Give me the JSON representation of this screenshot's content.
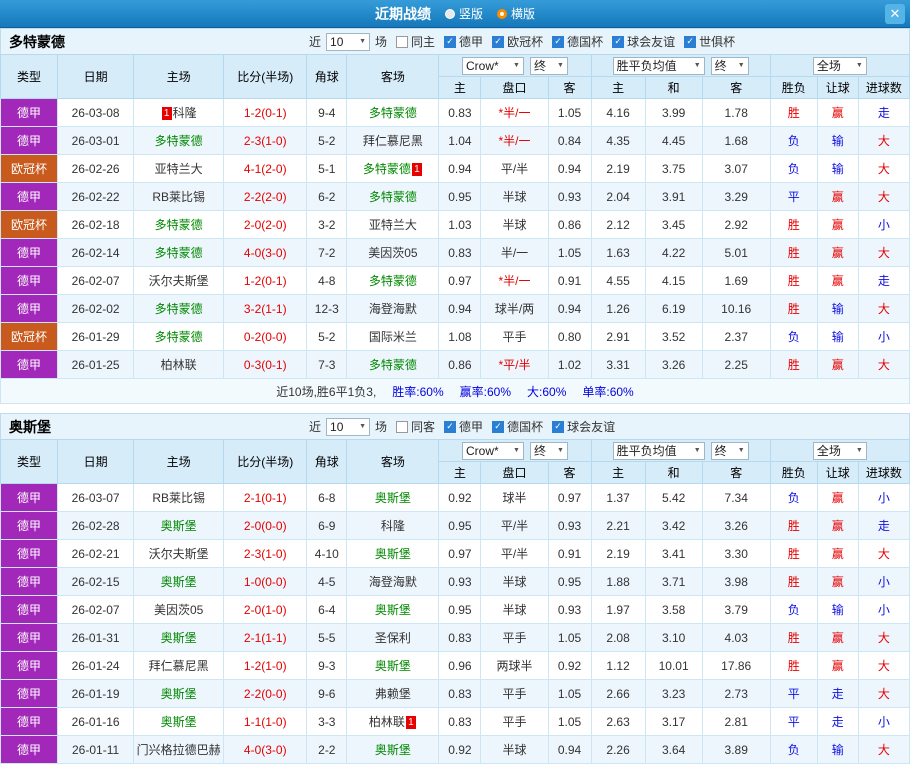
{
  "titlebar": {
    "title": "近期战绩",
    "radio_vertical": "竖版",
    "radio_horizontal": "横版",
    "close": "✕"
  },
  "colors": {
    "league": {
      "德甲": "#a128b8",
      "欧冠杯": "#c85a1d"
    },
    "team_green": "#008800",
    "win_red": "#e60000",
    "lose_blue": "#1010e0"
  },
  "table_header": {
    "cols": [
      "类型",
      "日期",
      "主场",
      "比分(半场)",
      "角球",
      "客场"
    ],
    "company_select": "Crow*",
    "final_select": "终",
    "avg_select": "胜平负均值",
    "scope_select": "全场",
    "sub_cols": [
      "主",
      "盘口",
      "客",
      "主",
      "和",
      "客",
      "胜负",
      "让球",
      "进球数"
    ]
  },
  "sections": [
    {
      "team": "多特蒙德",
      "filter": {
        "near": "近",
        "count": "10",
        "unit": "场",
        "checkboxes": [
          {
            "label": "同主",
            "checked": false
          },
          {
            "label": "德甲",
            "checked": true
          },
          {
            "label": "欧冠杯",
            "checked": true
          },
          {
            "label": "德国杯",
            "checked": true
          },
          {
            "label": "球会友谊",
            "checked": true
          },
          {
            "label": "世俱杯",
            "checked": true
          }
        ]
      },
      "rows": [
        {
          "league": "德甲",
          "date": "26-03-08",
          "home": {
            "name": "科隆",
            "green": false,
            "badge_before": "1"
          },
          "score": "1-2(0-1)",
          "corner": "9-4",
          "away": {
            "name": "多特蒙德",
            "green": true
          },
          "odds": [
            "0.83",
            "*半/一",
            "1.05"
          ],
          "handicap_red": true,
          "avg": [
            "4.16",
            "3.99",
            "1.78"
          ],
          "results": [
            {
              "text": "胜",
              "color": "red"
            },
            {
              "text": "赢",
              "color": "red"
            },
            {
              "text": "走",
              "color": "blue"
            }
          ]
        },
        {
          "league": "德甲",
          "date": "26-03-01",
          "home": {
            "name": "多特蒙德",
            "green": true
          },
          "score": "2-3(1-0)",
          "corner": "5-2",
          "away": {
            "name": "拜仁慕尼黑",
            "green": false
          },
          "odds": [
            "1.04",
            "*半/一",
            "0.84"
          ],
          "handicap_red": true,
          "avg": [
            "4.35",
            "4.45",
            "1.68"
          ],
          "results": [
            {
              "text": "负",
              "color": "blue"
            },
            {
              "text": "输",
              "color": "blue"
            },
            {
              "text": "大",
              "color": "red"
            }
          ]
        },
        {
          "league": "欧冠杯",
          "date": "26-02-26",
          "home": {
            "name": "亚特兰大",
            "green": false
          },
          "score": "4-1(2-0)",
          "corner": "5-1",
          "away": {
            "name": "多特蒙德",
            "green": true,
            "badge_after": "1"
          },
          "odds": [
            "0.94",
            "平/半",
            "0.94"
          ],
          "handicap_red": false,
          "avg": [
            "2.19",
            "3.75",
            "3.07"
          ],
          "results": [
            {
              "text": "负",
              "color": "blue"
            },
            {
              "text": "输",
              "color": "blue"
            },
            {
              "text": "大",
              "color": "red"
            }
          ]
        },
        {
          "league": "德甲",
          "date": "26-02-22",
          "home": {
            "name": "RB莱比锡",
            "green": false
          },
          "score": "2-2(2-0)",
          "corner": "6-2",
          "away": {
            "name": "多特蒙德",
            "green": true
          },
          "odds": [
            "0.95",
            "半球",
            "0.93"
          ],
          "handicap_red": false,
          "avg": [
            "2.04",
            "3.91",
            "3.29"
          ],
          "results": [
            {
              "text": "平",
              "color": "blue"
            },
            {
              "text": "赢",
              "color": "red"
            },
            {
              "text": "大",
              "color": "red"
            }
          ]
        },
        {
          "league": "欧冠杯",
          "date": "26-02-18",
          "home": {
            "name": "多特蒙德",
            "green": true
          },
          "score": "2-0(2-0)",
          "corner": "3-2",
          "away": {
            "name": "亚特兰大",
            "green": false
          },
          "odds": [
            "1.03",
            "半球",
            "0.86"
          ],
          "handicap_red": false,
          "avg": [
            "2.12",
            "3.45",
            "2.92"
          ],
          "results": [
            {
              "text": "胜",
              "color": "red"
            },
            {
              "text": "赢",
              "color": "red"
            },
            {
              "text": "小",
              "color": "blue"
            }
          ]
        },
        {
          "league": "德甲",
          "date": "26-02-14",
          "home": {
            "name": "多特蒙德",
            "green": true
          },
          "score": "4-0(3-0)",
          "corner": "7-2",
          "away": {
            "name": "美因茨05",
            "green": false
          },
          "odds": [
            "0.83",
            "半/一",
            "1.05"
          ],
          "handicap_red": false,
          "avg": [
            "1.63",
            "4.22",
            "5.01"
          ],
          "results": [
            {
              "text": "胜",
              "color": "red"
            },
            {
              "text": "赢",
              "color": "red"
            },
            {
              "text": "大",
              "color": "red"
            }
          ]
        },
        {
          "league": "德甲",
          "date": "26-02-07",
          "home": {
            "name": "沃尔夫斯堡",
            "green": false
          },
          "score": "1-2(0-1)",
          "corner": "4-8",
          "away": {
            "name": "多特蒙德",
            "green": true
          },
          "odds": [
            "0.97",
            "*半/一",
            "0.91"
          ],
          "handicap_red": true,
          "avg": [
            "4.55",
            "4.15",
            "1.69"
          ],
          "results": [
            {
              "text": "胜",
              "color": "red"
            },
            {
              "text": "赢",
              "color": "red"
            },
            {
              "text": "走",
              "color": "blue"
            }
          ]
        },
        {
          "league": "德甲",
          "date": "26-02-02",
          "home": {
            "name": "多特蒙德",
            "green": true
          },
          "score": "3-2(1-1)",
          "corner": "12-3",
          "away": {
            "name": "海登海默",
            "green": false
          },
          "odds": [
            "0.94",
            "球半/两",
            "0.94"
          ],
          "handicap_red": false,
          "avg": [
            "1.26",
            "6.19",
            "10.16"
          ],
          "results": [
            {
              "text": "胜",
              "color": "red"
            },
            {
              "text": "输",
              "color": "blue"
            },
            {
              "text": "大",
              "color": "red"
            }
          ]
        },
        {
          "league": "欧冠杯",
          "date": "26-01-29",
          "home": {
            "name": "多特蒙德",
            "green": true
          },
          "score": "0-2(0-0)",
          "corner": "5-2",
          "away": {
            "name": "国际米兰",
            "green": false
          },
          "odds": [
            "1.08",
            "平手",
            "0.80"
          ],
          "handicap_red": false,
          "avg": [
            "2.91",
            "3.52",
            "2.37"
          ],
          "results": [
            {
              "text": "负",
              "color": "blue"
            },
            {
              "text": "输",
              "color": "blue"
            },
            {
              "text": "小",
              "color": "blue"
            }
          ]
        },
        {
          "league": "德甲",
          "date": "26-01-25",
          "home": {
            "name": "柏林联",
            "green": false
          },
          "score": "0-3(0-1)",
          "corner": "7-3",
          "away": {
            "name": "多特蒙德",
            "green": true
          },
          "odds": [
            "0.86",
            "*平/半",
            "1.02"
          ],
          "handicap_red": true,
          "avg": [
            "3.31",
            "3.26",
            "2.25"
          ],
          "results": [
            {
              "text": "胜",
              "color": "red"
            },
            {
              "text": "赢",
              "color": "red"
            },
            {
              "text": "大",
              "color": "red"
            }
          ]
        }
      ],
      "summary": {
        "text": "近10场,胜6平1负3,",
        "stats": [
          "胜率:60%",
          "赢率:60%",
          "大:60%",
          "单率:60%"
        ]
      }
    },
    {
      "team": "奥斯堡",
      "filter": {
        "near": "近",
        "count": "10",
        "unit": "场",
        "checkboxes": [
          {
            "label": "同客",
            "checked": false
          },
          {
            "label": "德甲",
            "checked": true
          },
          {
            "label": "德国杯",
            "checked": true
          },
          {
            "label": "球会友谊",
            "checked": true
          }
        ]
      },
      "rows": [
        {
          "league": "德甲",
          "date": "26-03-07",
          "home": {
            "name": "RB莱比锡",
            "green": false
          },
          "score": "2-1(0-1)",
          "corner": "6-8",
          "away": {
            "name": "奥斯堡",
            "green": true
          },
          "odds": [
            "0.92",
            "球半",
            "0.97"
          ],
          "handicap_red": false,
          "avg": [
            "1.37",
            "5.42",
            "7.34"
          ],
          "results": [
            {
              "text": "负",
              "color": "blue"
            },
            {
              "text": "赢",
              "color": "red"
            },
            {
              "text": "小",
              "color": "blue"
            }
          ]
        },
        {
          "league": "德甲",
          "date": "26-02-28",
          "home": {
            "name": "奥斯堡",
            "green": true
          },
          "score": "2-0(0-0)",
          "corner": "6-9",
          "away": {
            "name": "科隆",
            "green": false
          },
          "odds": [
            "0.95",
            "平/半",
            "0.93"
          ],
          "handicap_red": false,
          "avg": [
            "2.21",
            "3.42",
            "3.26"
          ],
          "results": [
            {
              "text": "胜",
              "color": "red"
            },
            {
              "text": "赢",
              "color": "red"
            },
            {
              "text": "走",
              "color": "blue"
            }
          ]
        },
        {
          "league": "德甲",
          "date": "26-02-21",
          "home": {
            "name": "沃尔夫斯堡",
            "green": false
          },
          "score": "2-3(1-0)",
          "corner": "4-10",
          "away": {
            "name": "奥斯堡",
            "green": true
          },
          "odds": [
            "0.97",
            "平/半",
            "0.91"
          ],
          "handicap_red": false,
          "avg": [
            "2.19",
            "3.41",
            "3.30"
          ],
          "results": [
            {
              "text": "胜",
              "color": "red"
            },
            {
              "text": "赢",
              "color": "red"
            },
            {
              "text": "大",
              "color": "red"
            }
          ]
        },
        {
          "league": "德甲",
          "date": "26-02-15",
          "home": {
            "name": "奥斯堡",
            "green": true
          },
          "score": "1-0(0-0)",
          "corner": "4-5",
          "away": {
            "name": "海登海默",
            "green": false
          },
          "odds": [
            "0.93",
            "半球",
            "0.95"
          ],
          "handicap_red": false,
          "avg": [
            "1.88",
            "3.71",
            "3.98"
          ],
          "results": [
            {
              "text": "胜",
              "color": "red"
            },
            {
              "text": "赢",
              "color": "red"
            },
            {
              "text": "小",
              "color": "blue"
            }
          ]
        },
        {
          "league": "德甲",
          "date": "26-02-07",
          "home": {
            "name": "美因茨05",
            "green": false
          },
          "score": "2-0(1-0)",
          "corner": "6-4",
          "away": {
            "name": "奥斯堡",
            "green": true
          },
          "odds": [
            "0.95",
            "半球",
            "0.93"
          ],
          "handicap_red": false,
          "avg": [
            "1.97",
            "3.58",
            "3.79"
          ],
          "results": [
            {
              "text": "负",
              "color": "blue"
            },
            {
              "text": "输",
              "color": "blue"
            },
            {
              "text": "小",
              "color": "blue"
            }
          ]
        },
        {
          "league": "德甲",
          "date": "26-01-31",
          "home": {
            "name": "奥斯堡",
            "green": true
          },
          "score": "2-1(1-1)",
          "corner": "5-5",
          "away": {
            "name": "圣保利",
            "green": false
          },
          "odds": [
            "0.83",
            "平手",
            "1.05"
          ],
          "handicap_red": false,
          "avg": [
            "2.08",
            "3.10",
            "4.03"
          ],
          "results": [
            {
              "text": "胜",
              "color": "red"
            },
            {
              "text": "赢",
              "color": "red"
            },
            {
              "text": "大",
              "color": "red"
            }
          ]
        },
        {
          "league": "德甲",
          "date": "26-01-24",
          "home": {
            "name": "拜仁慕尼黑",
            "green": false
          },
          "score": "1-2(1-0)",
          "corner": "9-3",
          "away": {
            "name": "奥斯堡",
            "green": true
          },
          "odds": [
            "0.96",
            "两球半",
            "0.92"
          ],
          "handicap_red": false,
          "avg": [
            "1.12",
            "10.01",
            "17.86"
          ],
          "results": [
            {
              "text": "胜",
              "color": "red"
            },
            {
              "text": "赢",
              "color": "red"
            },
            {
              "text": "大",
              "color": "red"
            }
          ]
        },
        {
          "league": "德甲",
          "date": "26-01-19",
          "home": {
            "name": "奥斯堡",
            "green": true
          },
          "score": "2-2(0-0)",
          "corner": "9-6",
          "away": {
            "name": "弗赖堡",
            "green": false
          },
          "odds": [
            "0.83",
            "平手",
            "1.05"
          ],
          "handicap_red": false,
          "avg": [
            "2.66",
            "3.23",
            "2.73"
          ],
          "results": [
            {
              "text": "平",
              "color": "blue"
            },
            {
              "text": "走",
              "color": "blue"
            },
            {
              "text": "大",
              "color": "red"
            }
          ]
        },
        {
          "league": "德甲",
          "date": "26-01-16",
          "home": {
            "name": "奥斯堡",
            "green": true
          },
          "score": "1-1(1-0)",
          "corner": "3-3",
          "away": {
            "name": "柏林联",
            "green": false,
            "badge_after": "1"
          },
          "odds": [
            "0.83",
            "平手",
            "1.05"
          ],
          "handicap_red": false,
          "avg": [
            "2.63",
            "3.17",
            "2.81"
          ],
          "results": [
            {
              "text": "平",
              "color": "blue"
            },
            {
              "text": "走",
              "color": "blue"
            },
            {
              "text": "小",
              "color": "blue"
            }
          ]
        },
        {
          "league": "德甲",
          "date": "26-01-11",
          "home": {
            "name": "门兴格拉德巴赫",
            "green": false
          },
          "score": "4-0(3-0)",
          "corner": "2-2",
          "away": {
            "name": "奥斯堡",
            "green": true
          },
          "odds": [
            "0.92",
            "半球",
            "0.94"
          ],
          "handicap_red": false,
          "avg": [
            "2.26",
            "3.64",
            "3.89"
          ],
          "results": [
            {
              "text": "负",
              "color": "blue"
            },
            {
              "text": "输",
              "color": "blue"
            },
            {
              "text": "大",
              "color": "red"
            }
          ]
        }
      ],
      "summary": null
    }
  ]
}
